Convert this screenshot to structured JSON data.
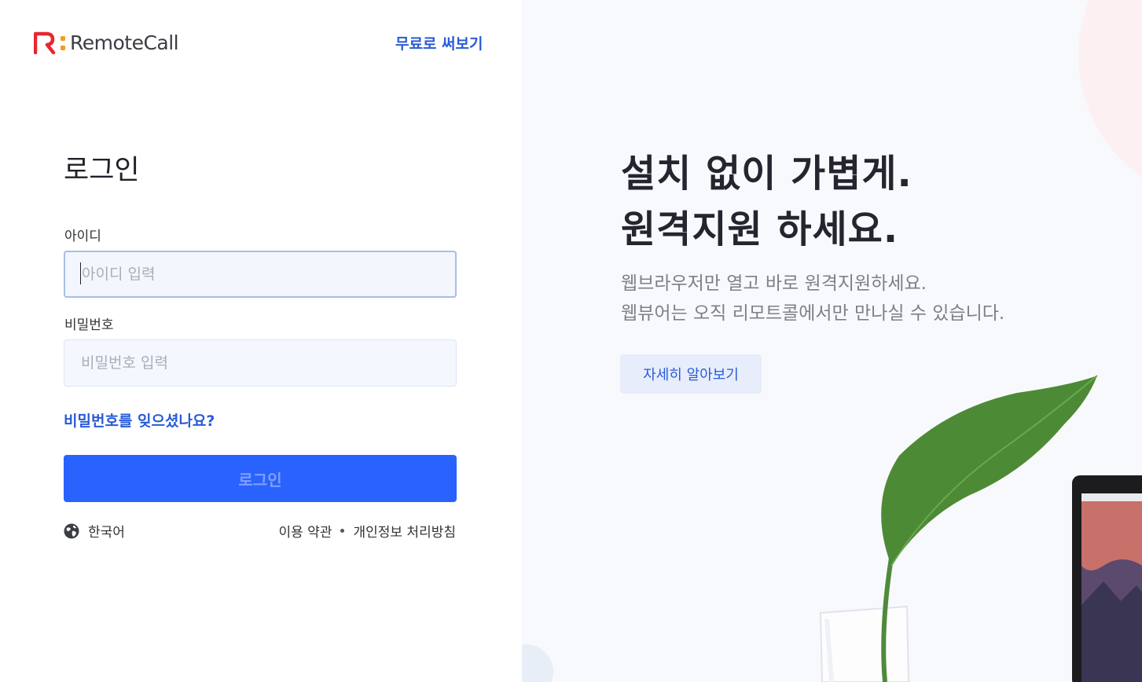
{
  "brand": {
    "name": "RemoteCall",
    "colors": {
      "accent": "#2a5bd7",
      "button": "#2a62fe",
      "logo_red": "#e8262f",
      "logo_orange": "#f39c1f"
    }
  },
  "header": {
    "free_trial_label": "무료로 써보기"
  },
  "login": {
    "title": "로그인",
    "id_label": "아이디",
    "id_placeholder": "아이디 입력",
    "id_value": "",
    "pw_label": "비밀번호",
    "pw_placeholder": "비밀번호 입력",
    "pw_value": "",
    "forgot_label": "비밀번호를 잊으셨나요?",
    "submit_label": "로그인"
  },
  "footer": {
    "language_label": "한국어",
    "language_icon": "globe-icon",
    "terms_label": "이용 약관",
    "privacy_label": "개인정보 처리방침"
  },
  "promo": {
    "headline_line1": "설치 없이 가볍게.",
    "headline_line2": "원격지원 하세요.",
    "sub_line1": "웹브라우저만 열고 바로 원격지원하세요.",
    "sub_line2": "웹뷰어는 오직 리모트콜에서만 만나실 수 있습니다.",
    "more_label": "자세히 알아보기"
  }
}
